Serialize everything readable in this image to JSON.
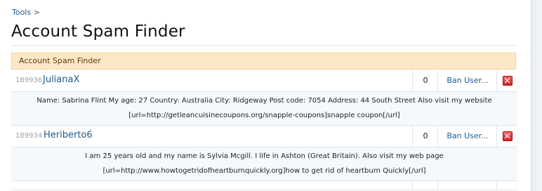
{
  "breadcrumb": {
    "link": "Tools",
    "separator": ">"
  },
  "page_title": "Account Spam Finder",
  "section_title": "Account Spam Finder",
  "users": [
    {
      "id": "189936",
      "name": "JulianaX",
      "count": "0",
      "ban_label": "Ban User...",
      "about_line1": "Name: Sabrina Flint My age: 27 Country: Australia City: Ridgeway Post code: 7054 Address: 44 South Street Also visit my website",
      "about_line2": "[url=http://getleancuisinecoupons.org/snapple-coupons]snapple coupon[/url]"
    },
    {
      "id": "189934",
      "name": "Heriberto6",
      "count": "0",
      "ban_label": "Ban User...",
      "about_line1": "I am 25 years old and my name is Sylvia Mcgill. I life in Ashton (Great Britain). Also visit my web page",
      "about_line2": "[url=http://www.howtogetridofheartburnquickly.org]how to get rid of heartburn Quickly[/url]"
    }
  ],
  "icons": {
    "delete": "delete-x-icon",
    "accent": "#d01c1c",
    "link": "#1d5b8e",
    "header_bg": "#fde8c5"
  }
}
